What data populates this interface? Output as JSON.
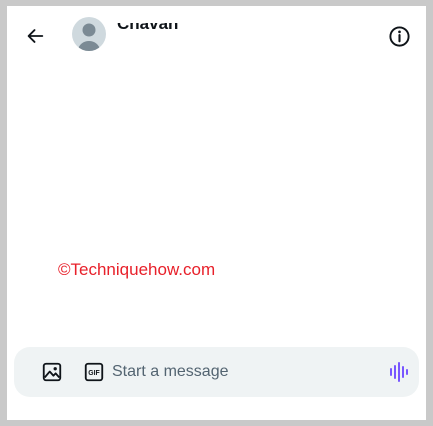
{
  "header": {
    "back_icon": "arrow-left-icon",
    "contact_name": "Chavan",
    "info_icon": "info-circle-icon"
  },
  "watermark": {
    "text": "©Techniquehow.com",
    "color": "#e8202a"
  },
  "composer": {
    "media_icon": "image-icon",
    "gif_icon": "gif-icon",
    "gif_label": "GIF",
    "placeholder": "Start a message",
    "value": "",
    "voice_icon": "voice-waveform-icon",
    "accent_color": "#7856ff"
  }
}
